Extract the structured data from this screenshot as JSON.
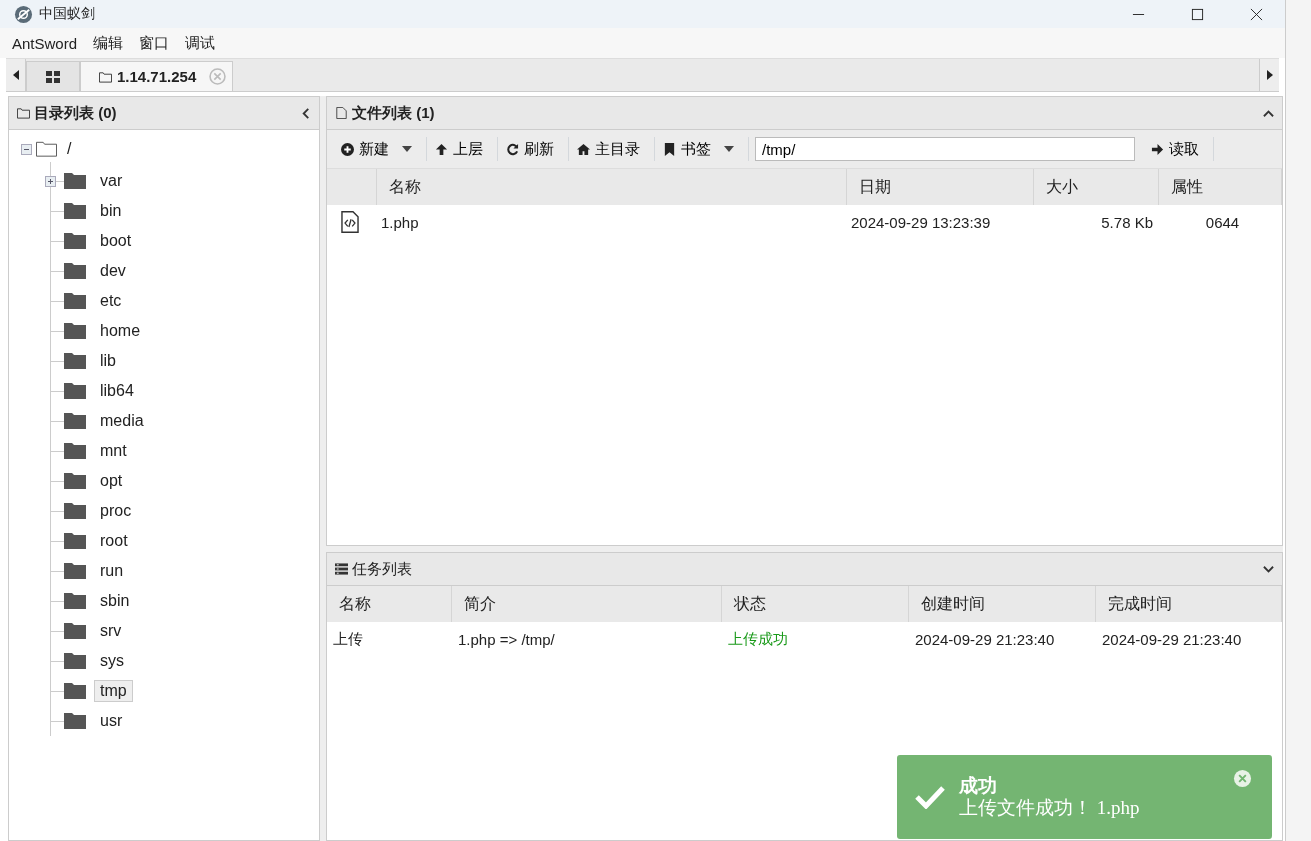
{
  "window": {
    "title": "中国蚁剑"
  },
  "menu": [
    "AntSword",
    "编辑",
    "窗口",
    "调试"
  ],
  "tabs": [
    {
      "kind": "home",
      "selected": false
    },
    {
      "kind": "shell",
      "label": "1.14.71.254",
      "selected": true
    }
  ],
  "directory_panel": {
    "title": "目录列表 (0)",
    "tree": {
      "label": "/",
      "expanded": true,
      "children": [
        {
          "label": "var",
          "expandable": true,
          "selected": false
        },
        {
          "label": "bin",
          "expandable": false,
          "selected": false
        },
        {
          "label": "boot",
          "expandable": false,
          "selected": false
        },
        {
          "label": "dev",
          "expandable": false,
          "selected": false
        },
        {
          "label": "etc",
          "expandable": false,
          "selected": false
        },
        {
          "label": "home",
          "expandable": false,
          "selected": false
        },
        {
          "label": "lib",
          "expandable": false,
          "selected": false
        },
        {
          "label": "lib64",
          "expandable": false,
          "selected": false
        },
        {
          "label": "media",
          "expandable": false,
          "selected": false
        },
        {
          "label": "mnt",
          "expandable": false,
          "selected": false
        },
        {
          "label": "opt",
          "expandable": false,
          "selected": false
        },
        {
          "label": "proc",
          "expandable": false,
          "selected": false
        },
        {
          "label": "root",
          "expandable": false,
          "selected": false
        },
        {
          "label": "run",
          "expandable": false,
          "selected": false
        },
        {
          "label": "sbin",
          "expandable": false,
          "selected": false
        },
        {
          "label": "srv",
          "expandable": false,
          "selected": false
        },
        {
          "label": "sys",
          "expandable": false,
          "selected": false
        },
        {
          "label": "tmp",
          "expandable": false,
          "selected": true
        },
        {
          "label": "usr",
          "expandable": false,
          "selected": false
        }
      ]
    }
  },
  "file_panel": {
    "title": "文件列表 (1)",
    "toolbar": [
      {
        "kind": "new",
        "label": "新建",
        "dropdown": true
      },
      {
        "kind": "up",
        "label": "上层",
        "dropdown": false
      },
      {
        "kind": "refresh",
        "label": "刷新",
        "dropdown": false
      },
      {
        "kind": "home",
        "label": "主目录",
        "dropdown": false
      },
      {
        "kind": "bookmark",
        "label": "书签",
        "dropdown": true
      }
    ],
    "path": "/tmp/",
    "read_button": "读取",
    "columns": [
      "名称",
      "日期",
      "大小",
      "属性"
    ],
    "rows": [
      {
        "name": "1.php",
        "date": "2024-09-29 13:23:39",
        "size": "5.78 Kb",
        "mode": "0644"
      }
    ]
  },
  "task_panel": {
    "title": "任务列表",
    "columns": [
      "名称",
      "简介",
      "状态",
      "创建时间",
      "完成时间"
    ],
    "rows": [
      {
        "name": "上传",
        "summary": "1.php => /tmp/",
        "status": "上传成功",
        "color": "#1a9a1a",
        "created": "2024-09-29 21:23:40",
        "finished": "2024-09-29 21:23:40"
      }
    ]
  },
  "toast": {
    "title": "成功",
    "message": "上传文件成功！ 1.php"
  }
}
